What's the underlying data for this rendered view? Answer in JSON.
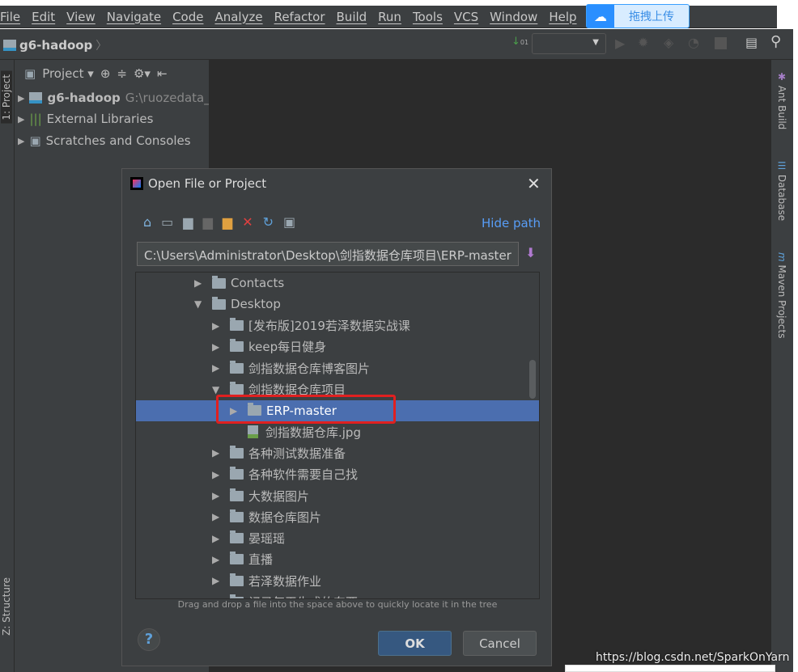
{
  "menu": [
    "File",
    "Edit",
    "View",
    "Navigate",
    "Code",
    "Analyze",
    "Refactor",
    "Build",
    "Run",
    "Tools",
    "VCS",
    "Window",
    "Help"
  ],
  "upload_label": "拖拽上传",
  "toolbar": {
    "project_name": "g6-hadoop"
  },
  "left_tabs": {
    "project": "1: Project",
    "structure": "Z: Structure"
  },
  "right_tabs": {
    "ant": "Ant Build",
    "database": "Database",
    "maven": "Maven Projects"
  },
  "project_panel": {
    "title": "Project",
    "items": [
      {
        "label": "g6-hadoop",
        "path": "G:\\ruozedata_"
      },
      {
        "label": "External Libraries"
      },
      {
        "label": "Scratches and Consoles"
      }
    ]
  },
  "dialog": {
    "title": "Open File or Project",
    "hide_path": "Hide path",
    "path": "C:\\Users\\Administrator\\Desktop\\剑指数据仓库项目\\ERP-master",
    "hint": "Drag and drop a file into the space above to quickly locate it in the tree",
    "ok": "OK",
    "cancel": "Cancel",
    "help": "?",
    "tree": [
      {
        "label": "Contacts",
        "level": 0,
        "expanded": false
      },
      {
        "label": "Desktop",
        "level": 0,
        "expanded": true
      },
      {
        "label": "[发布版]2019若泽数据实战课",
        "level": 1,
        "expanded": false
      },
      {
        "label": "keep每日健身",
        "level": 1,
        "expanded": false
      },
      {
        "label": "剑指数据仓库博客图片",
        "level": 1,
        "expanded": false
      },
      {
        "label": "剑指数据仓库项目",
        "level": 1,
        "expanded": true
      },
      {
        "label": "ERP-master",
        "level": 2,
        "expanded": false,
        "selected": true
      },
      {
        "label": "剑指数据仓库.jpg",
        "level": 2,
        "file": true
      },
      {
        "label": "各种测试数据准备",
        "level": 1,
        "expanded": false
      },
      {
        "label": "各种软件需要自己找",
        "level": 1,
        "expanded": false
      },
      {
        "label": "大数据图片",
        "level": 1,
        "expanded": false
      },
      {
        "label": "数据仓库图片",
        "level": 1,
        "expanded": false
      },
      {
        "label": "晏瑶瑶",
        "level": 1,
        "expanded": false
      },
      {
        "label": "直播",
        "level": 1,
        "expanded": false
      },
      {
        "label": "若泽数据作业",
        "level": 1,
        "expanded": false
      },
      {
        "label": "记录每天生成的东西",
        "level": 1,
        "expanded": false
      }
    ]
  },
  "watermark": "https://blog.csdn.net/SparkOnYarn",
  "colors": {
    "selection": "#4b6eaf",
    "highlight_box": "#e02020",
    "ok_button": "#365880"
  }
}
